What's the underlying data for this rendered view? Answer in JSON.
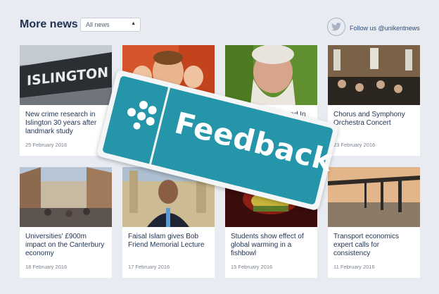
{
  "header": {
    "title": "More news",
    "filter": {
      "selected": "All news"
    },
    "follow_text": "Follow us @unikentnews"
  },
  "icons": {
    "twitter": "twitter-icon",
    "select_arrow": "chevron-up-down-icon",
    "feedback_logo": "dots-cluster-icon"
  },
  "articles": [
    {
      "headline": "New crime research in Islington 30 years after landmark study",
      "date": "25 February 2016"
    },
    {
      "headline": "",
      "date": ""
    },
    {
      "headline": "Robert Wyatt live and In Conversation",
      "date": ""
    },
    {
      "headline": "Chorus and Symphony Orchestra Concert",
      "date": "23 February 2016"
    },
    {
      "headline": "Universities' £900m impact on the Canterbury economy",
      "date": "18 February 2016"
    },
    {
      "headline": "Faisal Islam gives Bob Friend Memorial Lecture",
      "date": "17 February 2016"
    },
    {
      "headline": "Students show effect of global warming in a fishbowl",
      "date": "15 February 2016"
    },
    {
      "headline": "Transport economics expert calls for consistency",
      "date": "11 February 2016"
    }
  ],
  "overlay": {
    "label": "Feedback"
  },
  "colors": {
    "feedback_teal": "#2596a9",
    "headline": "#1f3150",
    "background": "#e8ecf2"
  }
}
